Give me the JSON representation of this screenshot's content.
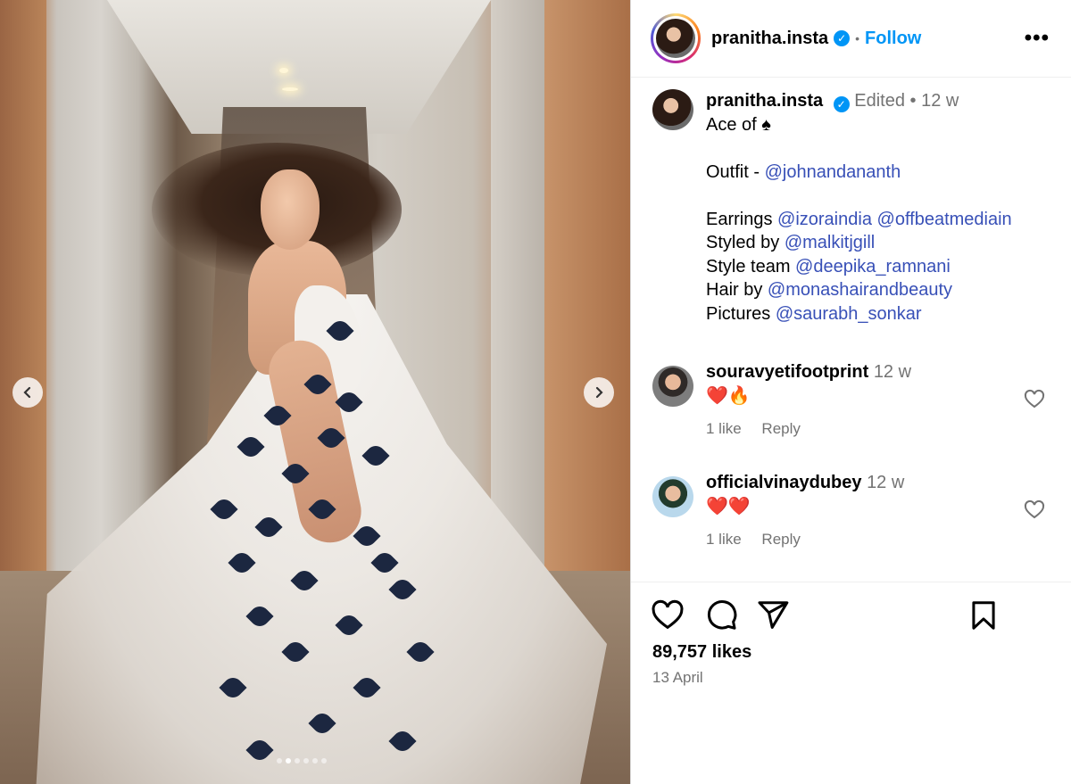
{
  "post": {
    "author": "pranitha.insta",
    "follow_label": "Follow",
    "separator": "•",
    "more_label": "•••",
    "edited_label": "Edited",
    "time_ago": "12 w",
    "caption_lines": [
      {
        "text": "Ace of ♠"
      },
      {
        "text": ""
      },
      {
        "prefix": "Outfit - ",
        "mention": "@johnandananth"
      },
      {
        "text": ""
      },
      {
        "prefix": "Earrings ",
        "mention": "@izoraindia",
        "mention2": "@offbeatmediain"
      },
      {
        "prefix": "Styled by ",
        "mention": "@malkitjgill"
      },
      {
        "prefix": "Style team ",
        "mention": "@deepika_ramnani"
      },
      {
        "prefix": "Hair by ",
        "mention": "@monashairandbeauty"
      },
      {
        "prefix": "Pictures ",
        "mention": "@saurabh_sonkar"
      }
    ],
    "likes": "89,757 likes",
    "date": "13 April"
  },
  "comments": [
    {
      "user": "souravyetifootprint",
      "time": "12 w",
      "text": "❤️🔥",
      "likes": "1 like",
      "reply": "Reply"
    },
    {
      "user": "officialvinaydubey",
      "time": "12 w",
      "text": "❤️❤️",
      "likes": "1 like",
      "reply": "Reply"
    }
  ],
  "carousel": {
    "dot_count": 6,
    "active_index": 1
  },
  "icons": {
    "verified": "verified-badge-icon",
    "prev": "chevron-left-icon",
    "next": "chevron-right-icon",
    "like": "heart-icon",
    "comment": "comment-icon",
    "share": "paper-plane-icon",
    "save": "bookmark-icon"
  },
  "colors": {
    "accent": "#0095f6",
    "mention": "#3850b7",
    "muted": "#737373"
  }
}
